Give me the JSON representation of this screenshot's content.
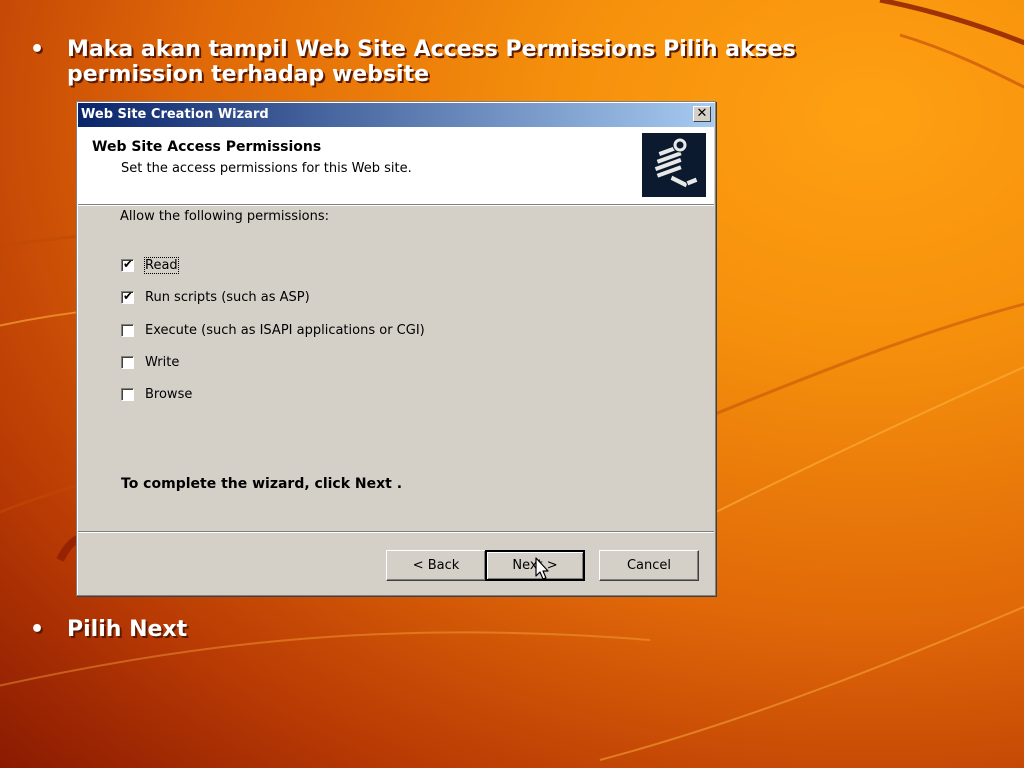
{
  "slide": {
    "bullet1": "Maka akan tampil Web Site Access Permissions Pilih akses permission terhadap website",
    "bullet2": "Pilih Next",
    "bullet_glyph": "•"
  },
  "dialog": {
    "title": "Web Site Creation Wizard",
    "close_glyph": "✕",
    "header_title": "Web Site Access Permissions",
    "header_subtitle": "Set the access permissions for this Web site.",
    "header_icon": "wizard-icon",
    "allow_label": "Allow the following permissions:",
    "permissions": [
      {
        "label": "Read",
        "checked": true
      },
      {
        "label": "Run scripts (such as ASP)",
        "checked": true
      },
      {
        "label": "Execute (such as ISAPI applications or CGI)",
        "checked": false
      },
      {
        "label": "Write",
        "checked": false
      },
      {
        "label": "Browse",
        "checked": false
      }
    ],
    "complete_text": "To complete the wizard, click Next .",
    "buttons": {
      "back": "< Back",
      "next": "Next >",
      "cancel": "Cancel"
    }
  },
  "colors": {
    "titlebar_start": "#0a246a",
    "titlebar_end": "#a6caf0",
    "dialog_face": "#d4d0c8",
    "background_accent": "#f5900c"
  }
}
